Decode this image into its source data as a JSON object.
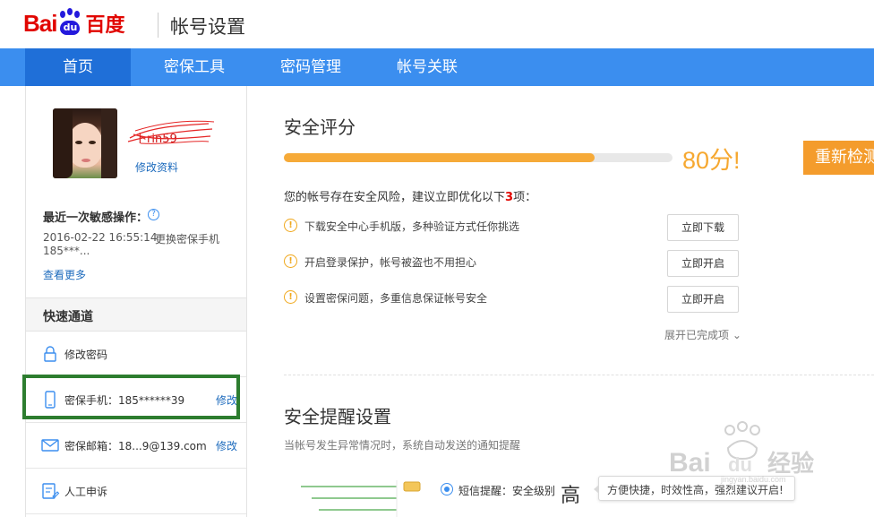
{
  "header": {
    "logo_text_1": "Bai",
    "logo_text_2": "du",
    "logo_text_3": "百度",
    "title": "帐号设置"
  },
  "nav": {
    "tabs": [
      {
        "label": "首页",
        "active": true
      },
      {
        "label": "密保工具",
        "active": false
      },
      {
        "label": "密码管理",
        "active": false
      },
      {
        "label": "帐号关联",
        "active": false
      }
    ]
  },
  "profile": {
    "username": "卜rin59",
    "edit_profile": "修改资料"
  },
  "recent": {
    "label": "最近一次敏感操作：",
    "time": "2016-02-22 16:55:14",
    "action": "更换密保手机",
    "phone": "185***...",
    "see_more": "查看更多"
  },
  "quick": {
    "title": "快速通道",
    "items": [
      {
        "label": "修改密码",
        "action": ""
      },
      {
        "label": "密保手机：185******39",
        "action": "修改"
      },
      {
        "label": "密保邮箱：18...9@139.com",
        "action": "修改"
      },
      {
        "label": "人工申诉",
        "action": ""
      }
    ]
  },
  "security": {
    "title": "安全评分",
    "score": 80,
    "score_text": "80分!",
    "recheck": "重新检测",
    "risk_prefix": "您的帐号存在安全风险，建议立即优化以下",
    "risk_count": "3",
    "risk_suffix": "项：",
    "risks": [
      {
        "text": "下载安全中心手机版，多种验证方式任你挑选",
        "button": "立即下载"
      },
      {
        "text": "开启登录保护，帐号被盗也不用担心",
        "button": "立即开启"
      },
      {
        "text": "设置密保问题，多重信息保证帐号安全",
        "button": "立即开启"
      }
    ],
    "expand": "展开已完成项"
  },
  "remind": {
    "title": "安全提醒设置",
    "subtitle": "当帐号发生异常情况时，系统自动发送的通知提醒",
    "sms_label": "短信提醒：安全级别",
    "level": "高",
    "tooltip": "方便快捷，时效性高，强烈建议开启!"
  },
  "colors": {
    "nav_bg": "#3b8eef",
    "nav_active": "#1f6fd8",
    "accent_orange": "#f6aa38",
    "link_blue": "#1d6bbd",
    "highlight_green": "#2d7d2f"
  }
}
